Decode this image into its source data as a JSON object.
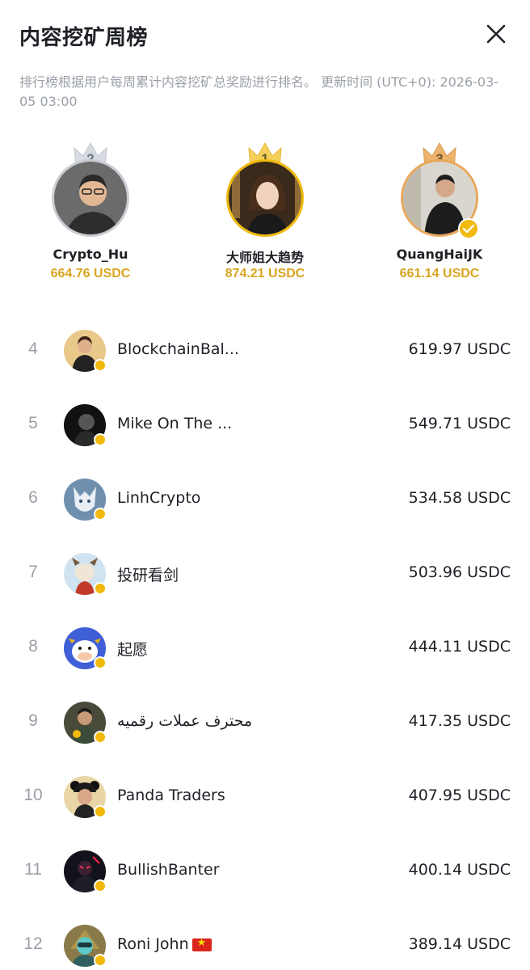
{
  "header": {
    "title": "内容挖矿周榜"
  },
  "description": "排行榜根据用户每周累计内容挖矿总奖励进行排名。 更新时间 (UTC+0): 2026-03-05 03:00",
  "podium": {
    "first": {
      "rank": "1",
      "name": "大师姐大趋势",
      "amount": "874.21 USDC"
    },
    "second": {
      "rank": "2",
      "name": "Crypto_Hu",
      "amount": "664.76 USDC"
    },
    "third": {
      "rank": "3",
      "name": "QuangHaiJK",
      "amount": "661.14 USDC"
    }
  },
  "list": [
    {
      "rank": "4",
      "name": "BlockchainBal...",
      "amount": "619.97 USDC"
    },
    {
      "rank": "5",
      "name": "Mike On The ...",
      "amount": "549.71 USDC"
    },
    {
      "rank": "6",
      "name": "LinhCrypto",
      "amount": "534.58 USDC"
    },
    {
      "rank": "7",
      "name": "投研看剑",
      "amount": "503.96 USDC"
    },
    {
      "rank": "8",
      "name": "起愿",
      "amount": "444.11 USDC"
    },
    {
      "rank": "9",
      "name": "محترف عملات رقميه",
      "amount": "417.35 USDC"
    },
    {
      "rank": "10",
      "name": "Panda Traders",
      "amount": "407.95 USDC"
    },
    {
      "rank": "11",
      "name": "BullishBanter",
      "amount": "400.14 USDC"
    },
    {
      "rank": "12",
      "name": "Roni John",
      "amount": "389.14 USDC"
    }
  ],
  "colors": {
    "gold": "#f0b90b",
    "amount_gold": "#d9a520",
    "muted": "#9ba0a8",
    "text": "#1e2026"
  },
  "icons": {
    "close": "close-icon",
    "crown": "crown-icon",
    "verified": "verified-badge-icon",
    "flag": "vietnam-flag-icon"
  }
}
